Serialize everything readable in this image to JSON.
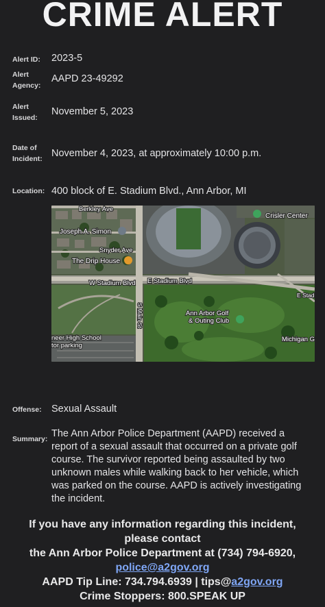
{
  "title": "CRIME ALERT",
  "fields": {
    "alert_id": {
      "label": "Alert ID:",
      "value": "2023-5"
    },
    "agency": {
      "label_line1": "Alert",
      "label_line2": "Agency:",
      "value": "AAPD 23-49292"
    },
    "issued": {
      "label_line1": "Alert",
      "label_line2": "Issued:",
      "value": "November 5, 2023"
    },
    "incident": {
      "label_line1": "Date of",
      "label_line2": "Incident:",
      "value": "November 4, 2023, at approximately 10:00 p.m."
    },
    "location": {
      "label": "Location:",
      "value": "400 block of E. Stadium Blvd., Ann Arbor, MI"
    },
    "offense": {
      "label": "Offense:",
      "value": "Sexual Assault"
    },
    "summary": {
      "label": "Summary:",
      "lines": [
        "The Ann Arbor Police Department (AAPD) received a",
        "report of a sexual assault that occurred on a private golf",
        "course. The survivor reported being assaulted by two",
        "unknown males while walking back to her vehicle, which",
        "was parked on the course. AAPD is actively investigating",
        "the incident."
      ]
    }
  },
  "map": {
    "labels": {
      "berkley": "Berkley Ave",
      "simon": "Joseph A. Simon",
      "snyder": "Snyder Ave",
      "drip": "The Drip House",
      "w_stadium": "W Stadium Blvd",
      "e_stadium": "E Stadium Blvd",
      "e_stad_right": "E Stad",
      "crisler": "Crisler Center",
      "main_st": "S Main St",
      "golf1": "Ann Arbor Golf",
      "golf2": "& Outing Club",
      "pioneer1": "neer High School",
      "pioneer2": "tor parking",
      "michigan": "Michigan G"
    },
    "colors": {
      "grass": "#3d6a2c",
      "road": "#b8b4a8",
      "pin_green": "#3fa35c",
      "pin_orange": "#e29a2c"
    }
  },
  "footer": {
    "line1": "If you have any information regarding this incident,",
    "line2": "please contact",
    "line3": "the Ann Arbor Police Department at (734) 794-6920,",
    "email": "police@a2gov.org",
    "tip_prefix": "AAPD Tip Line: 734.794.6939 | tips@",
    "tip_link": "a2gov.org",
    "stoppers": "Crime Stoppers: 800.SPEAK UP"
  }
}
